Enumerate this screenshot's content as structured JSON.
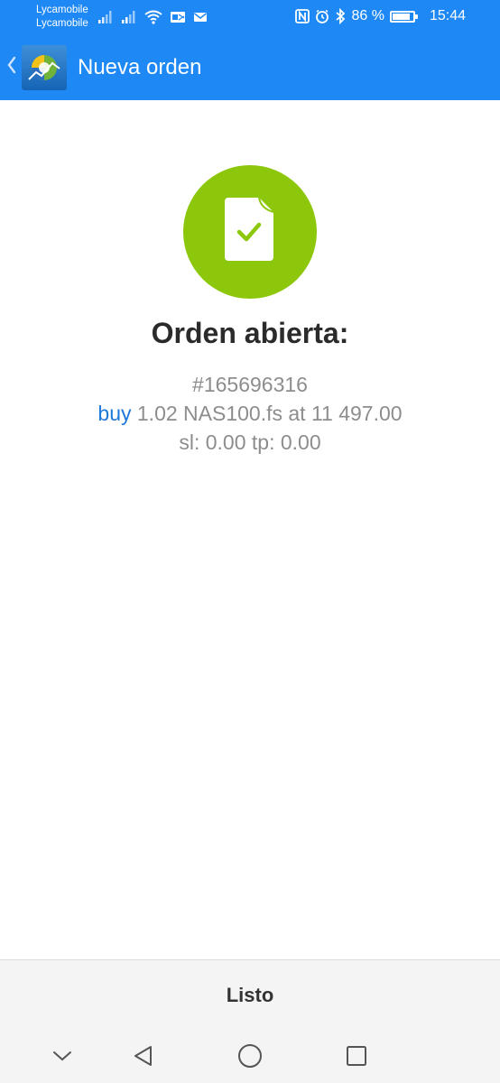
{
  "status_bar": {
    "carrier_1": "Lycamobile",
    "carrier_2": "Lycamobile",
    "battery_percent": "86 %",
    "battery_level": 0.86,
    "time": "15:44"
  },
  "toolbar": {
    "title": "Nueva orden"
  },
  "result": {
    "title": "Orden abierta:",
    "order_number": "#165696316",
    "side": "buy",
    "order_summary": " 1.02 NAS100.fs at 11 497.00",
    "sl_tp": "sl: 0.00 tp: 0.00"
  },
  "actions": {
    "done_label": "Listo"
  },
  "colors": {
    "header_blue": "#1e88f5",
    "success_green": "#8cc70b",
    "buy_blue": "#1e78d8",
    "text_gray": "#8d8d8d"
  },
  "icons": {
    "back": "chevron-left-icon",
    "success": "document-check-icon",
    "nav_hide": "chevron-down-icon",
    "nav_back": "triangle-back-icon",
    "nav_home": "circle-home-icon",
    "nav_recents": "square-recents-icon"
  }
}
